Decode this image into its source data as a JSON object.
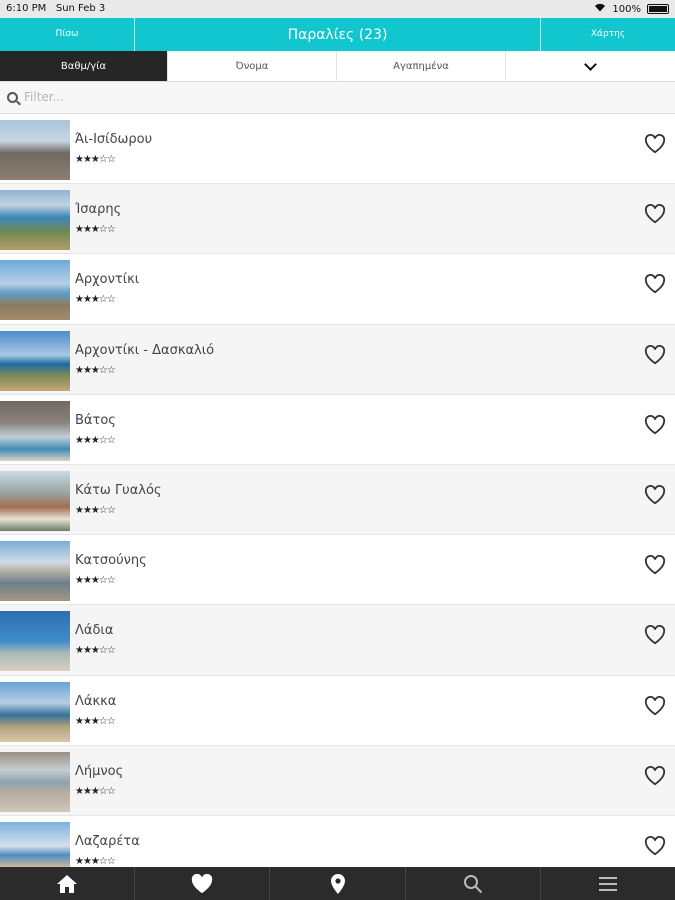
{
  "status_bar": {
    "time": "6:10 PM",
    "date": "Sun Feb 3",
    "battery": "100%"
  },
  "header": {
    "back_label": "Πίσω",
    "title": "Παραλίες (23)",
    "map_label": "Χάρτης"
  },
  "sort_tabs": {
    "rating": "Βαθμ/γία",
    "name": "Όνομα",
    "favorites": "Αγαπημένα"
  },
  "filter": {
    "placeholder": "Filter..."
  },
  "beaches": [
    {
      "name": "Άι-Ισίδωρου",
      "stars": "★★★☆☆",
      "rating": 3
    },
    {
      "name": "Ίσαρης",
      "stars": "★★★☆☆",
      "rating": 3
    },
    {
      "name": "Αρχοντίκι",
      "stars": "★★★☆☆",
      "rating": 3
    },
    {
      "name": "Αρχοντίκι - Δασκαλιό",
      "stars": "★★★☆☆",
      "rating": 3
    },
    {
      "name": "Βάτος",
      "stars": "★★★☆☆",
      "rating": 3
    },
    {
      "name": "Κάτω Γυαλός",
      "stars": "★★★☆☆",
      "rating": 3
    },
    {
      "name": "Κατσούνης",
      "stars": "★★★☆☆",
      "rating": 3
    },
    {
      "name": "Λάδια",
      "stars": "★★★☆☆",
      "rating": 3
    },
    {
      "name": "Λάκκα",
      "stars": "★★★☆☆",
      "rating": 3
    },
    {
      "name": "Λήμνος",
      "stars": "★★★☆☆",
      "rating": 3
    },
    {
      "name": "Λαζαρέτα",
      "stars": "★★★☆☆",
      "rating": 3
    }
  ],
  "icons": {
    "heart": "heart-outline-icon",
    "home": "home-icon",
    "favorites": "heart-filled-icon",
    "map": "map-pin-icon",
    "search": "search-icon",
    "menu": "menu-icon"
  },
  "colors": {
    "accent": "#12c6cf",
    "tab_active": "#262626",
    "bottom_bar": "#2b2b2b"
  }
}
